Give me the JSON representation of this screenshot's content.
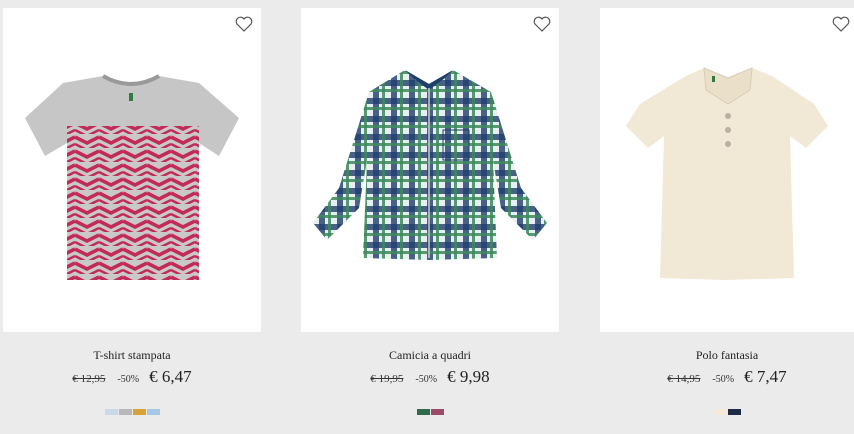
{
  "products": [
    {
      "name": "T-shirt stampata",
      "old_price": "€ 12,95",
      "discount": "-50%",
      "new_price": "€ 6,47",
      "favorite_icon": "heart-outline-icon",
      "swatches": [
        "#c9d9ea",
        "#b8b8b8",
        "#d8a23a",
        "#a6c8e6"
      ]
    },
    {
      "name": "Camicia a quadri",
      "old_price": "€ 19,95",
      "discount": "-50%",
      "new_price": "€ 9,98",
      "favorite_icon": "heart-outline-icon",
      "swatches": [
        "#2f6b4a",
        "#9c4a6a"
      ]
    },
    {
      "name": "Polo fantasia",
      "old_price": "€ 14,95",
      "discount": "-50%",
      "new_price": "€ 7,47",
      "favorite_icon": "heart-outline-icon",
      "swatches": [
        "#f3e9d6",
        "#1f2a44"
      ]
    }
  ],
  "colors": {
    "background": "#ebebeb",
    "card": "#ffffff",
    "text": "#222222"
  }
}
